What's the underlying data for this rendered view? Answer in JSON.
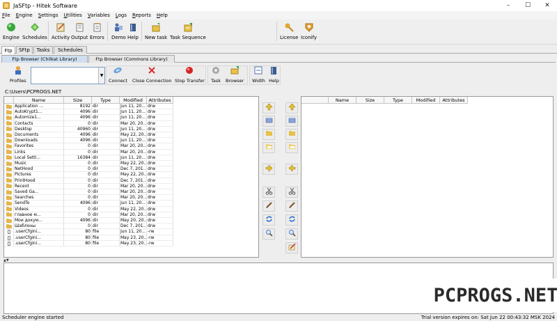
{
  "window": {
    "title": "JaSFtp - Hitek Software",
    "controls": [
      "–",
      "☐",
      "✕"
    ]
  },
  "menu": [
    "File",
    "Engine",
    "Settings",
    "Utilities",
    "Variables",
    "Logs",
    "Reports",
    "Help"
  ],
  "toolbar": {
    "buttons": [
      {
        "label": "Engine",
        "icon": "engine-icon"
      },
      {
        "label": "Schedules",
        "icon": "schedules-icon"
      },
      {
        "label": "Activity",
        "icon": "activity-icon"
      },
      {
        "label": "Output",
        "icon": "output-icon"
      },
      {
        "label": "Errors",
        "icon": "errors-icon"
      },
      {
        "label": "Demo",
        "icon": "demo-icon"
      },
      {
        "label": "Help",
        "icon": "help-icon"
      },
      {
        "label": "New task",
        "icon": "new-task-icon"
      },
      {
        "label": "Task Sequence",
        "icon": "task-sequence-icon"
      },
      {
        "label": "License",
        "icon": "license-icon"
      },
      {
        "label": "Iconify",
        "icon": "iconify-icon"
      }
    ]
  },
  "main_tabs": [
    {
      "label": "Ftp",
      "active": true
    },
    {
      "label": "SFtp",
      "active": false
    },
    {
      "label": "Tasks",
      "active": false
    },
    {
      "label": "Schedules",
      "active": false
    }
  ],
  "sub_tabs": [
    {
      "label": "Ftp Browser (Chilkat Library)",
      "active": true
    },
    {
      "label": "Ftp Browser (Commons Library)",
      "active": false
    }
  ],
  "ftp_toolbar": {
    "profiles_label": "Profiles",
    "host_value": "",
    "buttons": [
      {
        "label": "Connect",
        "icon": "connect-icon"
      },
      {
        "label": "Close Connection",
        "icon": "close-connection-icon"
      },
      {
        "label": "Stop Transfer",
        "icon": "stop-transfer-icon"
      },
      {
        "label": "Task",
        "icon": "task-icon"
      },
      {
        "label": "Browser",
        "icon": "browser-icon"
      },
      {
        "label": "Width",
        "icon": "width-icon"
      },
      {
        "label": "Help",
        "icon": "help-book-icon"
      }
    ]
  },
  "local": {
    "path": "C:\\Users\\PCPROGS.NET",
    "columns": [
      "Name",
      "Size",
      "Type",
      "Modified",
      "Attributes"
    ],
    "rows": [
      {
        "kind": "folder",
        "name": "Application ...",
        "size": "8192",
        "type": "dir",
        "modified": "Jun 11, 20...",
        "attr": "drw"
      },
      {
        "kind": "folder",
        "name": "AutoKrypt1...",
        "size": "4096",
        "type": "dir",
        "modified": "Jun 11, 20...",
        "attr": "drw"
      },
      {
        "kind": "folder",
        "name": "Automize1...",
        "size": "4096",
        "type": "dir",
        "modified": "Jun 11, 20...",
        "attr": "drw"
      },
      {
        "kind": "folder",
        "name": "Contacts",
        "size": "0",
        "type": "dir",
        "modified": "Mar 20, 20...",
        "attr": "drw"
      },
      {
        "kind": "folder",
        "name": "Desktop",
        "size": "40960",
        "type": "dir",
        "modified": "Jun 11, 20...",
        "attr": "drw"
      },
      {
        "kind": "folder",
        "name": "Documents",
        "size": "4096",
        "type": "dir",
        "modified": "May 22, 20...",
        "attr": "drw"
      },
      {
        "kind": "folder",
        "name": "Downloads",
        "size": "4096",
        "type": "dir",
        "modified": "Jun 11, 20...",
        "attr": "drw"
      },
      {
        "kind": "folder",
        "name": "Favorites",
        "size": "0",
        "type": "dir",
        "modified": "Mar 20, 20...",
        "attr": "drw"
      },
      {
        "kind": "folder",
        "name": "Links",
        "size": "0",
        "type": "dir",
        "modified": "Mar 20, 20...",
        "attr": "drw"
      },
      {
        "kind": "folder",
        "name": "Local Setti...",
        "size": "16384",
        "type": "dir",
        "modified": "Jun 11, 20...",
        "attr": "drw"
      },
      {
        "kind": "folder",
        "name": "Music",
        "size": "0",
        "type": "dir",
        "modified": "May 22, 20...",
        "attr": "drw"
      },
      {
        "kind": "folder",
        "name": "NetHood",
        "size": "0",
        "type": "dir",
        "modified": "Dec 7, 201...",
        "attr": "drw"
      },
      {
        "kind": "folder",
        "name": "Pictures",
        "size": "0",
        "type": "dir",
        "modified": "May 22, 20...",
        "attr": "drw"
      },
      {
        "kind": "folder",
        "name": "PrintHood",
        "size": "0",
        "type": "dir",
        "modified": "Dec 7, 201...",
        "attr": "drw"
      },
      {
        "kind": "folder",
        "name": "Recent",
        "size": "0",
        "type": "dir",
        "modified": "Mar 20, 20...",
        "attr": "drw"
      },
      {
        "kind": "folder",
        "name": "Saved Ga...",
        "size": "0",
        "type": "dir",
        "modified": "Mar 20, 20...",
        "attr": "drw"
      },
      {
        "kind": "folder",
        "name": "Searches",
        "size": "0",
        "type": "dir",
        "modified": "Mar 20, 20...",
        "attr": "drw"
      },
      {
        "kind": "folder",
        "name": "SendTo",
        "size": "4096",
        "type": "dir",
        "modified": "Jun 11, 20...",
        "attr": "drw"
      },
      {
        "kind": "folder",
        "name": "Videos",
        "size": "0",
        "type": "dir",
        "modified": "May 22, 20...",
        "attr": "drw"
      },
      {
        "kind": "folder",
        "name": "главное м...",
        "size": "0",
        "type": "dir",
        "modified": "Mar 20, 20...",
        "attr": "drw"
      },
      {
        "kind": "folder",
        "name": "Мои докум...",
        "size": "4096",
        "type": "dir",
        "modified": "May 20, 20...",
        "attr": "drw"
      },
      {
        "kind": "folder",
        "name": "Шаблоны",
        "size": "0",
        "type": "dir",
        "modified": "Dec 7, 201...",
        "attr": "drw"
      },
      {
        "kind": "file",
        "name": ".userCfgIni...",
        "size": "80",
        "type": "file",
        "modified": "Jun 11, 20...",
        "attr": "-rw"
      },
      {
        "kind": "file",
        "name": ".userCfgIni...",
        "size": "80",
        "type": "file",
        "modified": "May 23, 20...",
        "attr": "-rw"
      },
      {
        "kind": "file",
        "name": ".userCfgIni...",
        "size": "80",
        "type": "file",
        "modified": "May 23, 20...",
        "attr": "-rw"
      }
    ]
  },
  "remote": {
    "columns": [
      "Name",
      "Size",
      "Type",
      "Modified",
      "Attributes"
    ]
  },
  "status": {
    "left": "Scheduler engine started",
    "right": "Trial version expires on: Sat Jun 22 00:43:32 MSK 2024"
  },
  "watermark": "PCPROGS.NET"
}
